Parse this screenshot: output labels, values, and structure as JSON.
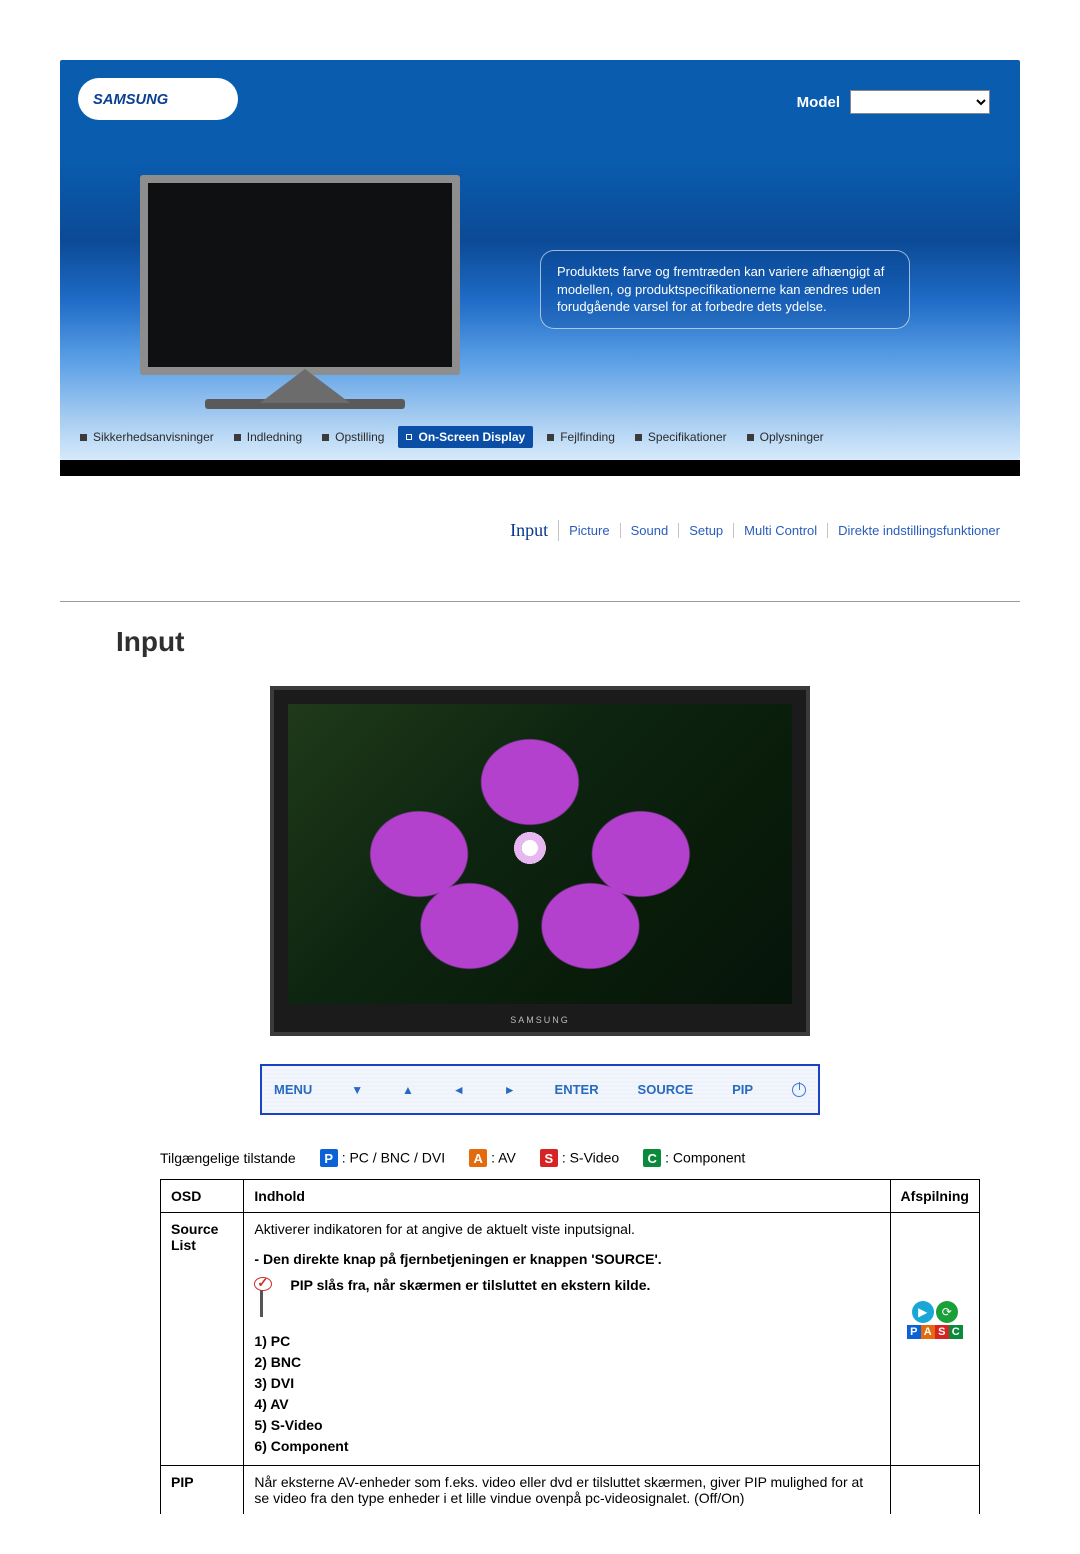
{
  "header": {
    "model_label": "Model",
    "disclaimer": "Produktets farve og fremtræden kan variere afhængigt af modellen, og produktspecifikationerne kan ændres uden forudgående varsel for at forbedre dets ydelse."
  },
  "nav": {
    "items": [
      {
        "label": "Sikkerhedsanvisninger"
      },
      {
        "label": "Indledning"
      },
      {
        "label": "Opstilling"
      },
      {
        "label": "On-Screen Display"
      },
      {
        "label": "Fejlfinding"
      },
      {
        "label": "Specifikationer"
      },
      {
        "label": "Oplysninger"
      }
    ],
    "active_index": 3
  },
  "sub_tabs": {
    "items": [
      "Input",
      "Picture",
      "Sound",
      "Setup",
      "Multi Control",
      "Direkte indstillingsfunktioner"
    ],
    "active_index": 0
  },
  "section_title": "Input",
  "tv_brand": "SAMSUNG",
  "controls": {
    "menu": "MENU",
    "enter": "ENTER",
    "source": "SOURCE",
    "pip": "PIP"
  },
  "legend": {
    "intro": "Tilgængelige tilstande",
    "p": ": PC / BNC / DVI",
    "a": ": AV",
    "s": ": S-Video",
    "c": ": Component"
  },
  "table": {
    "headers": {
      "osd": "OSD",
      "indhold": "Indhold",
      "afspilning": "Afspilning"
    },
    "rows": [
      {
        "osd": "Source List",
        "desc": "Aktiverer indikatoren for at angive de aktuelt viste inputsignal.",
        "note": "- Den direkte knap på fjernbetjeningen er knappen 'SOURCE'.",
        "pip_note": "PIP slås fra, når skærmen er tilsluttet en ekstern kilde.",
        "list": [
          "1) PC",
          "2) BNC",
          "3) DVI",
          "4) AV",
          "5) S-Video",
          "6) Component"
        ]
      },
      {
        "osd": "PIP",
        "desc": "Når eksterne AV-enheder som f.eks. video eller dvd er tilsluttet skærmen, giver PIP mulighed for at se video fra den type enheder i et lille vindue ovenpå pc-videosignalet. (Off/On)"
      }
    ]
  },
  "play_strip": [
    "P",
    "A",
    "S",
    "C"
  ]
}
